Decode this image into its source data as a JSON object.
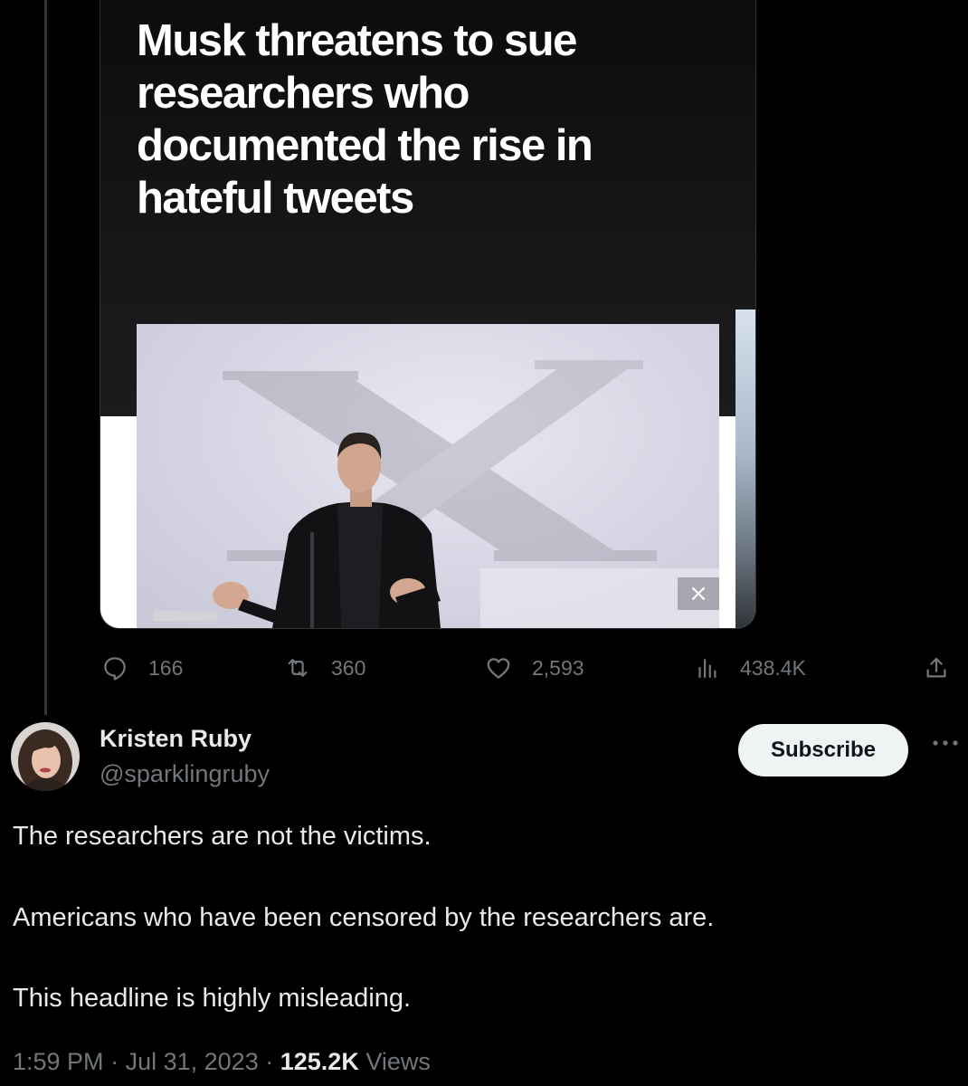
{
  "embedded_card": {
    "headline": "Musk threatens to sue researchers who documented the rise in hateful tweets",
    "photo_logo_letter": "X",
    "close_glyph": "×"
  },
  "actions": {
    "reply": {
      "icon": "reply-icon",
      "count": "166"
    },
    "retweet": {
      "icon": "retweet-icon",
      "count": "360"
    },
    "like": {
      "icon": "heart-icon",
      "count": "2,593"
    },
    "views": {
      "icon": "views-bar-chart-icon",
      "count": "438.4K"
    },
    "share": {
      "icon": "share-icon"
    }
  },
  "tweet": {
    "display_name": "Kristen Ruby",
    "handle": "@sparklingruby",
    "subscribe_label": "Subscribe",
    "more_icon": "more-icon",
    "paragraphs": [
      "The researchers are not the victims.",
      "Americans who have been censored by the researchers are.",
      "This headline is highly misleading."
    ],
    "time": "1:59 PM",
    "separator": "·",
    "date": "Jul 31, 2023",
    "view_count": "125.2K",
    "views_label": "Views"
  },
  "colors": {
    "background": "#000000",
    "text_primary": "#e7e9ea",
    "text_secondary": "#71767b",
    "subscribe_bg": "#eff3f4",
    "border": "#2f3336"
  }
}
